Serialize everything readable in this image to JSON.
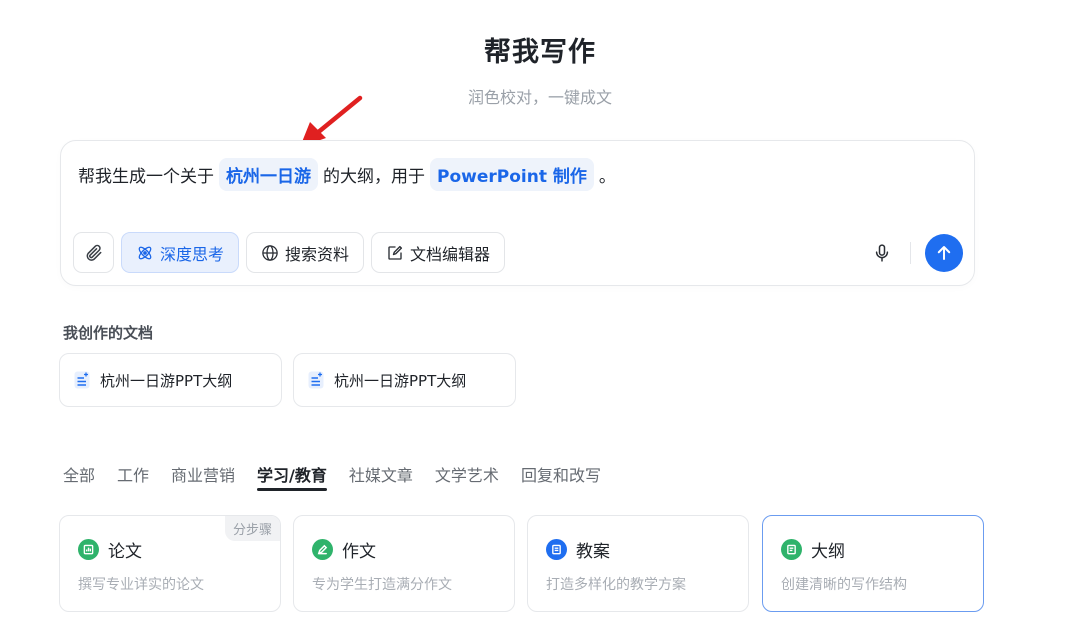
{
  "page": {
    "title": "帮我写作",
    "subtitle": "润色校对，一键成文"
  },
  "composer": {
    "prompt": {
      "before": "帮我生成一个关于",
      "slot1": "杭州一日游",
      "middle": "的大纲，用于",
      "slot2": "PowerPoint 制作",
      "after": "。"
    },
    "tools": [
      {
        "label": "",
        "icon": "paperclip-icon"
      },
      {
        "label": "深度思考",
        "icon": "atom-icon",
        "active": true
      },
      {
        "label": "搜索资料",
        "icon": "globe-icon"
      },
      {
        "label": "文档编辑器",
        "icon": "edit-doc-icon"
      }
    ],
    "mic_icon": "microphone-icon",
    "send_icon": "arrow-up-icon"
  },
  "my_docs": {
    "label": "我创作的文档",
    "items": [
      {
        "title": "杭州一日游PPT大纲",
        "icon": "document-icon"
      },
      {
        "title": "杭州一日游PPT大纲",
        "icon": "document-icon"
      }
    ]
  },
  "tabs": [
    {
      "label": "全部"
    },
    {
      "label": "工作"
    },
    {
      "label": "商业营销"
    },
    {
      "label": "学习/教育",
      "active": true
    },
    {
      "label": "社媒文章"
    },
    {
      "label": "文学艺术"
    },
    {
      "label": "回复和改写"
    }
  ],
  "templates": [
    {
      "title": "论文",
      "desc": "撰写专业详实的论文",
      "badge": "分步骤",
      "color": "#2fb36b",
      "icon": "chart-icon"
    },
    {
      "title": "作文",
      "desc": "专为学生打造满分作文",
      "color": "#2fb36b",
      "icon": "pen-icon"
    },
    {
      "title": "教案",
      "desc": "打造多样化的教学方案",
      "color": "#1f6ef0",
      "icon": "book-icon"
    },
    {
      "title": "大纲",
      "desc": "创建清晰的写作结构",
      "color": "#2fb36b",
      "icon": "outline-icon",
      "selected": true
    }
  ],
  "colors": {
    "accent": "#1f6ef0",
    "chip_bg": "#eef3fb",
    "annotation_arrow": "#e02020"
  }
}
